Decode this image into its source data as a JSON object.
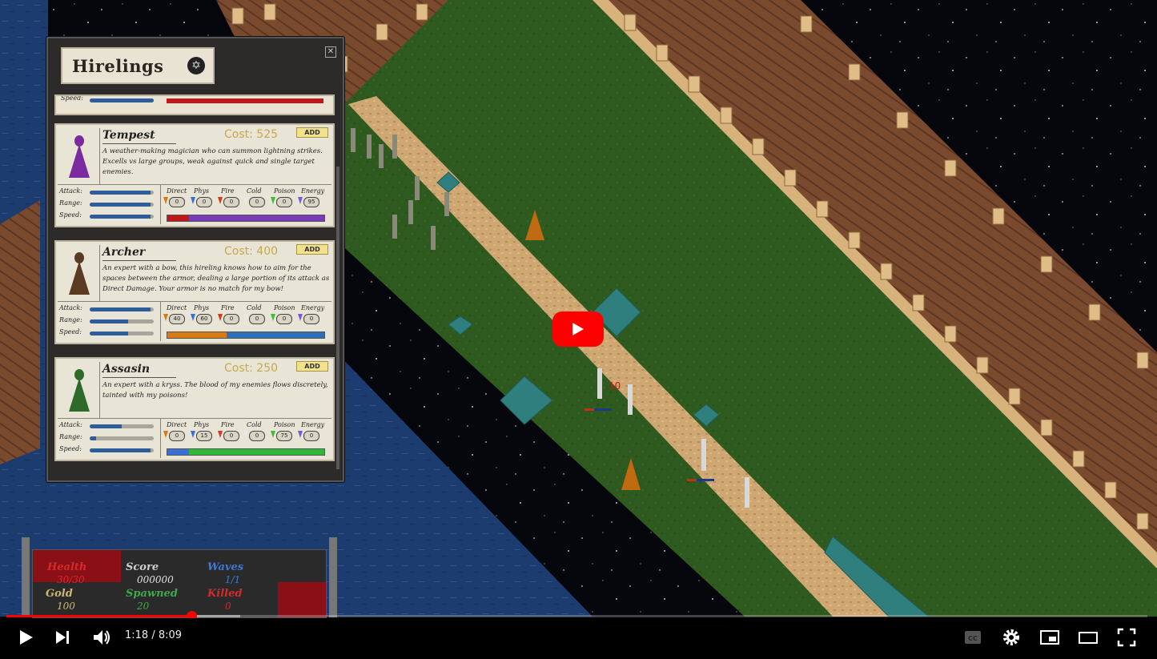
{
  "player": {
    "current_time": "1:18",
    "separator": "/",
    "duration": "8:09",
    "progress_fraction": 0.162,
    "buffered_fraction": 0.205,
    "accent": "#ff0000"
  },
  "hirelings": {
    "title": "Hirelings",
    "close_glyph": "✕",
    "add_label": "ADD",
    "resist_headers": [
      "Direct",
      "Phys",
      "Fire",
      "Cold",
      "Poison",
      "Energy"
    ],
    "stat_labels": [
      "Attack:",
      "Range:",
      "Speed:"
    ],
    "partial_label": "Speed:",
    "cards": [
      {
        "name": "Tempest",
        "cost": "Cost: 525",
        "desc": "A weather-making magician who can summon lightning strikes. Excells vs large groups, weak against quick and single target enemies.",
        "stats": [
          0.95,
          0.95,
          0.95
        ],
        "resists": [
          "0",
          "0",
          "0",
          "0",
          "0",
          "95"
        ],
        "portrait_color": "#7b2aa0"
      },
      {
        "name": "Archer",
        "cost": "Cost: 400",
        "desc": "An expert with a bow, this hireling knows how to aim for the spaces between the armor, dealing a large portion of its attack as Direct Damage. Your armor is no match for my bow!",
        "stats": [
          0.95,
          0.6,
          0.6
        ],
        "resists": [
          "40",
          "60",
          "0",
          "0",
          "0",
          "0"
        ],
        "portrait_color": "#5a3a22"
      },
      {
        "name": "Assasin",
        "cost": "Cost: 250",
        "desc": "An expert with a kryss. The blood of my enemies flows discretely, tainted with my poisons!",
        "stats": [
          0.5,
          0.1,
          0.95
        ],
        "resists": [
          "0",
          "15",
          "0",
          "0",
          "75",
          "0"
        ],
        "portrait_color": "#2e6b2b"
      }
    ]
  },
  "scoreboard": {
    "health_label": "Health",
    "health_value": "30/30",
    "score_label": "Score",
    "score_value": "000000",
    "waves_label": "Waves",
    "waves_value": "1/1",
    "gold_label": "Gold",
    "gold_value": "100",
    "spawned_label": "Spawned",
    "spawned_value": "20",
    "killed_label": "Killed",
    "killed_value": "0"
  },
  "damage_popup": "10"
}
